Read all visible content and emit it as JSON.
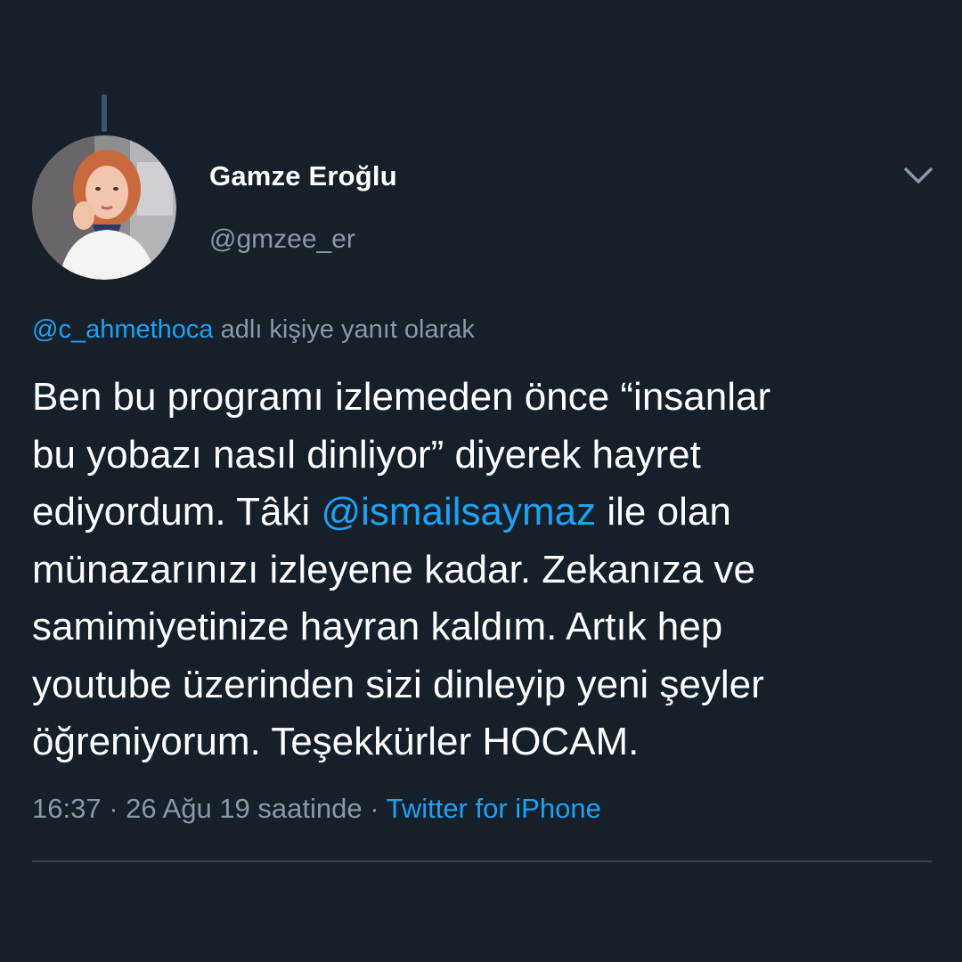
{
  "author": {
    "display_name": "Gamze Eroğlu",
    "handle": "@gmzee_er"
  },
  "reply_context": {
    "mention": "@c_ahmethoca",
    "suffix": " adlı kişiye yanıt olarak"
  },
  "tweet": {
    "lines": [
      "Ben bu programı izlemeden önce “insanlar",
      "bu yobazı nasıl dinliyor” diyerek hayret",
      "ediyordum. Tâki ",
      "@ismailsaymaz",
      " ile olan",
      "münazarınızı izleyene kadar. Zekanıza ve",
      "samimiyetinize hayran kaldım. Artık hep",
      "youtube üzerinden sizi dinleyip yeni şeyler",
      "öğreniyorum. Teşekkürler HOCAM."
    ]
  },
  "meta": {
    "time": "16:37",
    "separator": " · ",
    "date": "26 Ağu 19 saatinde",
    "source": "Twitter for iPhone"
  },
  "icons": {
    "caret": "chevron-down-icon",
    "avatar": "profile-photo"
  },
  "colors": {
    "background": "#15202b",
    "text": "#ffffff",
    "secondary": "#8899a6",
    "accent": "#1da1f2",
    "divider": "#38444d"
  }
}
